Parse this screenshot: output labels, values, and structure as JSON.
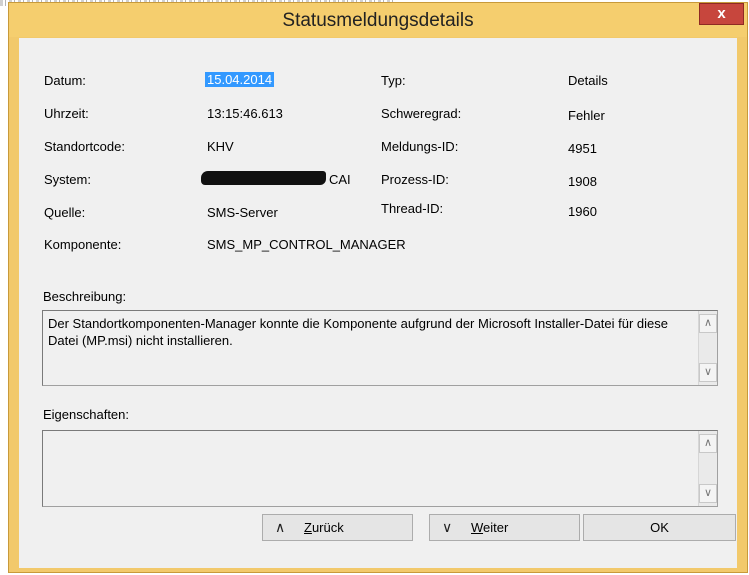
{
  "window": {
    "title": "Statusmeldungsdetails",
    "close_glyph": "x"
  },
  "details": {
    "datum_label": "Datum:",
    "datum_value": "15.04.2014",
    "uhrzeit_label": "Uhrzeit:",
    "uhrzeit_value": "13:15:46.613",
    "standortcode_label": "Standortcode:",
    "standortcode_value": "KHV",
    "system_label": "System:",
    "system_value_suffix": "CAI",
    "quelle_label": "Quelle:",
    "quelle_value": "SMS-Server",
    "komponente_label": "Komponente:",
    "komponente_value": "SMS_MP_CONTROL_MANAGER",
    "typ_label": "Typ:",
    "typ_value": "Details",
    "schweregrad_label": "Schweregrad:",
    "schweregrad_value": "Fehler",
    "meldungs_id_label": "Meldungs-ID:",
    "meldungs_id_value": "4951",
    "prozess_id_label": "Prozess-ID:",
    "prozess_id_value": "1908",
    "thread_id_label": "Thread-ID:",
    "thread_id_value": "1960"
  },
  "beschreibung": {
    "label": "Beschreibung:",
    "text": "Der Standortkomponenten-Manager konnte die Komponente aufgrund der Microsoft Installer-Datei für diese Datei (MP.msi) nicht installieren."
  },
  "eigenschaften": {
    "label": "Eigenschaften:",
    "text": ""
  },
  "buttons": {
    "back_access": "Z",
    "back_rest": "urück",
    "next_access": "W",
    "next_rest": "eiter",
    "ok": "OK"
  },
  "colors": {
    "titlebar": "#f5ce6e",
    "close": "#c7463d",
    "selection": "#3399ff"
  }
}
